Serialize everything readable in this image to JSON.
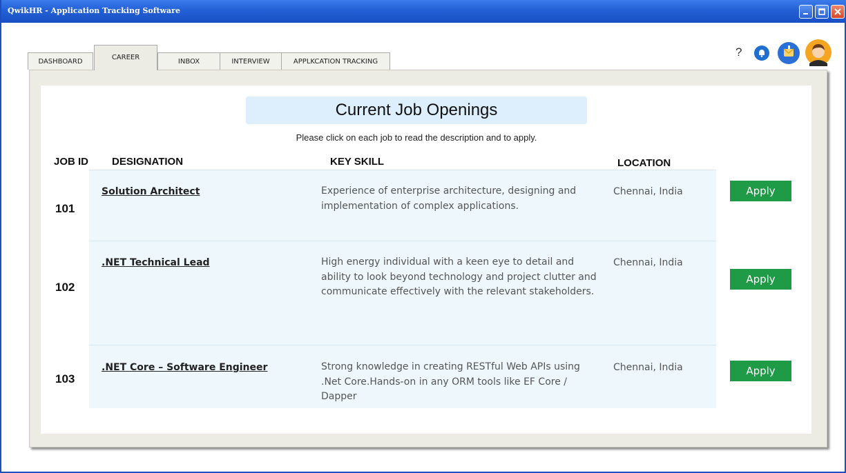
{
  "window": {
    "title": "QwikHR - Application Tracking Software",
    "buttons": [
      "minimize-icon",
      "maximize-icon",
      "close-icon"
    ],
    "accent": "#1f4fbf"
  },
  "tabs": [
    {
      "label": "DASHBOARD",
      "active": false
    },
    {
      "label": "CAREER",
      "active": true
    },
    {
      "label": "INBOX",
      "active": false
    },
    {
      "label": "INTERVIEW",
      "active": false
    },
    {
      "label": "APPLKCATION TRACKING",
      "active": false
    }
  ],
  "header_icons": {
    "help": "?",
    "icons": [
      "help-icon",
      "notification-bell-icon",
      "messages-icon",
      "user-avatar-icon"
    ]
  },
  "page": {
    "heading": "Current Job Openings",
    "subtitle": "Please click on each job to read the description and to apply."
  },
  "columns": {
    "job_id": "JOB ID",
    "designation": "DESIGNATION",
    "key_skill": "KEY SKILL",
    "location": "LOCATION"
  },
  "jobs": [
    {
      "id": "101",
      "designation": "Solution Architect",
      "skill": "Experience of enterprise architecture, designing and implementation of complex applications.",
      "location": "Chennai, India",
      "action": "Apply"
    },
    {
      "id": "102",
      "designation": ".NET Technical Lead",
      "skill": "High energy individual with a keen eye to detail and ability to look beyond technology and project clutter and communicate effectively with the relevant stakeholders.",
      "location": "Chennai, India",
      "action": "Apply"
    },
    {
      "id": "103",
      "designation": ".NET Core – Software Engineer",
      "skill": "Strong knowledge in creating RESTful Web APIs using .Net Core.Hands-on in any ORM tools like EF Core / Dapper",
      "location": "Chennai, India",
      "action": "Apply"
    }
  ],
  "colors": {
    "apply_button": "#1f9a46",
    "row_background": "#eef7fc",
    "heading_background": "#ddeefc"
  }
}
